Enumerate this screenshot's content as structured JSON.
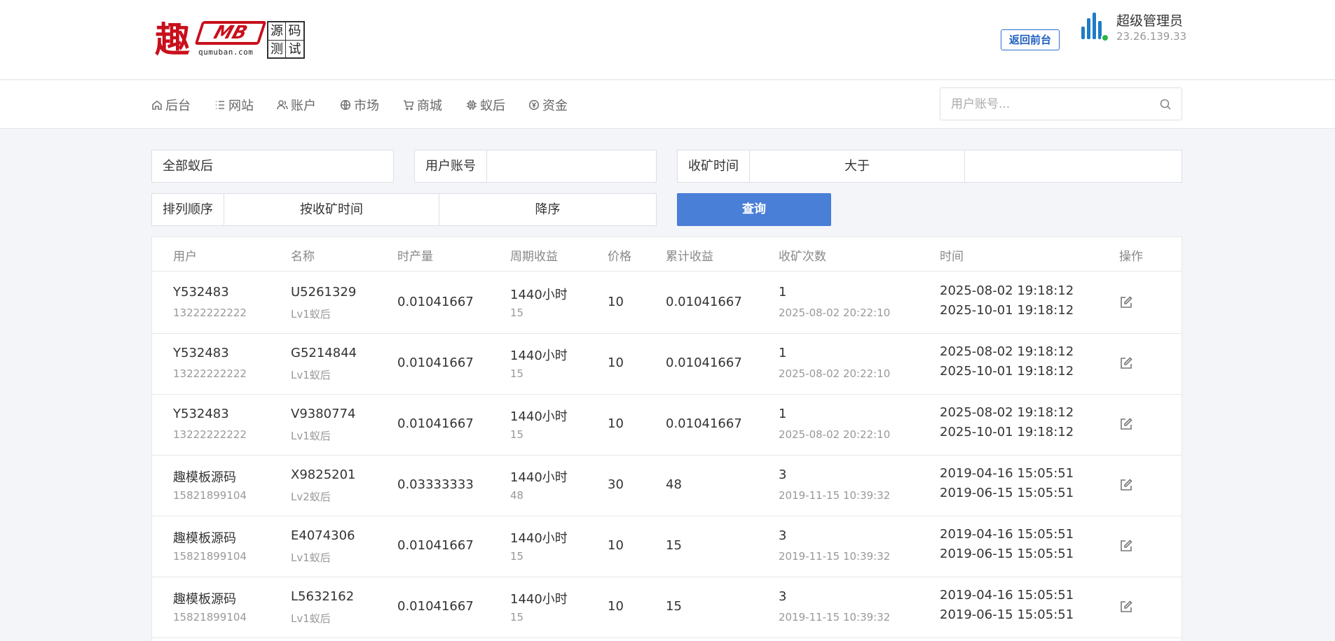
{
  "header": {
    "logo": {
      "char": "趣",
      "mb": "MB",
      "domain": "qumuban.com",
      "grid": [
        "源",
        "码",
        "测",
        "试"
      ]
    },
    "back_label": "返回前台",
    "admin_name": "超级管理员",
    "admin_ip": "23.26.139.33"
  },
  "nav": {
    "items": [
      {
        "label": "后台",
        "icon": "home-icon"
      },
      {
        "label": "网站",
        "icon": "list-icon"
      },
      {
        "label": "账户",
        "icon": "user-icon"
      },
      {
        "label": "市场",
        "icon": "globe-icon"
      },
      {
        "label": "商城",
        "icon": "cart-icon"
      },
      {
        "label": "蚁后",
        "icon": "chip-icon"
      },
      {
        "label": "资金",
        "icon": "coin-icon"
      }
    ],
    "search_placeholder": "用户账号..."
  },
  "filters": {
    "type_select": "全部蚁后",
    "account_label": "用户账号",
    "account_value": "",
    "harvest_label": "收矿时间",
    "harvest_op": "大于",
    "harvest_value": "",
    "sort_label": "排列顺序",
    "sort_by": "按收矿时间",
    "sort_dir": "降序",
    "query_label": "查询"
  },
  "table": {
    "headers": [
      "用户",
      "名称",
      "时产量",
      "周期收益",
      "价格",
      "累计收益",
      "收矿次数",
      "时间",
      "操作"
    ],
    "rows": [
      {
        "user": "Y532483",
        "phone": "13222222222",
        "name": "U5261329",
        "level": "Lv1蚁后",
        "rate": "0.01041667",
        "cycle": "1440小时",
        "cycle_sub": "15",
        "price": "10",
        "total": "0.01041667",
        "count": "1",
        "count_time": "2025-08-02 20:22:10",
        "t1": "2025-08-02 19:18:12",
        "t2": "2025-10-01 19:18:12"
      },
      {
        "user": "Y532483",
        "phone": "13222222222",
        "name": "G5214844",
        "level": "Lv1蚁后",
        "rate": "0.01041667",
        "cycle": "1440小时",
        "cycle_sub": "15",
        "price": "10",
        "total": "0.01041667",
        "count": "1",
        "count_time": "2025-08-02 20:22:10",
        "t1": "2025-08-02 19:18:12",
        "t2": "2025-10-01 19:18:12"
      },
      {
        "user": "Y532483",
        "phone": "13222222222",
        "name": "V9380774",
        "level": "Lv1蚁后",
        "rate": "0.01041667",
        "cycle": "1440小时",
        "cycle_sub": "15",
        "price": "10",
        "total": "0.01041667",
        "count": "1",
        "count_time": "2025-08-02 20:22:10",
        "t1": "2025-08-02 19:18:12",
        "t2": "2025-10-01 19:18:12"
      },
      {
        "user": "趣模板源码",
        "phone": "15821899104",
        "name": "X9825201",
        "level": "Lv2蚁后",
        "rate": "0.03333333",
        "cycle": "1440小时",
        "cycle_sub": "48",
        "price": "30",
        "total": "48",
        "count": "3",
        "count_time": "2019-11-15 10:39:32",
        "t1": "2019-04-16 15:05:51",
        "t2": "2019-06-15 15:05:51"
      },
      {
        "user": "趣模板源码",
        "phone": "15821899104",
        "name": "E4074306",
        "level": "Lv1蚁后",
        "rate": "0.01041667",
        "cycle": "1440小时",
        "cycle_sub": "15",
        "price": "10",
        "total": "15",
        "count": "3",
        "count_time": "2019-11-15 10:39:32",
        "t1": "2019-04-16 15:05:51",
        "t2": "2019-06-15 15:05:51"
      },
      {
        "user": "趣模板源码",
        "phone": "15821899104",
        "name": "L5632162",
        "level": "Lv1蚁后",
        "rate": "0.01041667",
        "cycle": "1440小时",
        "cycle_sub": "15",
        "price": "10",
        "total": "15",
        "count": "3",
        "count_time": "2019-11-15 10:39:32",
        "t1": "2019-04-16 15:05:51",
        "t2": "2019-06-15 15:05:51"
      }
    ]
  }
}
